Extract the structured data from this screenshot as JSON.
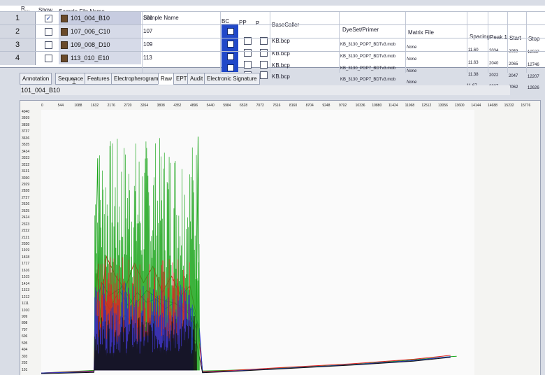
{
  "grid": {
    "headers": {
      "row": "R...",
      "show": "Show",
      "sample_file_name": "Sample File Name",
      "sample_name": "Sample Name",
      "bc": "BC",
      "pp": "PP",
      "p": "P",
      "base_caller": "BaseCaller",
      "dye_set_primer": "DyeSet/Primer",
      "matrix_file": "Matrix File",
      "spacing": "Spacing",
      "peak1": "Peak 1",
      "start": "Start",
      "stop": "Stop"
    },
    "rows": [
      {
        "num": "1",
        "checked": "✓",
        "file": "101_004_B10",
        "sample": "101",
        "basecaller": "KB.bcp",
        "dyeset": "KB_3130_POP7_BDTv3.mob",
        "matrix": "None",
        "spacing": "11.60",
        "peak1": "2034",
        "start": "2059",
        "stop": "12537"
      },
      {
        "num": "2",
        "checked": "",
        "file": "107_006_C10",
        "sample": "107",
        "basecaller": "KB.bcp",
        "dyeset": "KB_3130_POP7_BDTv3.mob",
        "matrix": "None",
        "spacing": "11.63",
        "peak1": "2040",
        "start": "2065",
        "stop": "12746"
      },
      {
        "num": "3",
        "checked": "",
        "file": "109_008_D10",
        "sample": "109",
        "basecaller": "KB.bcp",
        "dyeset": "KB_3130_POP7_BDTv3.mob",
        "matrix": "None",
        "spacing": "11.38",
        "peak1": "2022",
        "start": "2047",
        "stop": "12207"
      },
      {
        "num": "4",
        "checked": "",
        "file": "113_010_E10",
        "sample": "113",
        "basecaller": "KB.bcp",
        "dyeset": "KB_3130_POP7_BDTv3.mob",
        "matrix": "None",
        "spacing": "11.67",
        "peak1": "2037",
        "start": "2062",
        "stop": "12626"
      }
    ]
  },
  "tabs": [
    {
      "label": "Annotation",
      "active": false
    },
    {
      "label": "Sequence",
      "active": false
    },
    {
      "label": "Features",
      "active": false
    },
    {
      "label": "Electropherogram",
      "active": false
    },
    {
      "label": "Raw",
      "active": true
    },
    {
      "label": "EPT",
      "active": false
    },
    {
      "label": "Audit",
      "active": false
    },
    {
      "label": "Electronic Signature",
      "active": false
    }
  ],
  "sample_label": "101_004_B10",
  "colors": {
    "trace_red": "#e02020",
    "trace_green": "#1aa51a",
    "trace_blue": "#2030c8",
    "trace_black": "#111111",
    "basecaller_column": "#2148c8",
    "selected_file_bg": "#c7cce0"
  },
  "chart_data": {
    "type": "line",
    "title": "",
    "xlabel": "",
    "ylabel": "",
    "x_ticks": [
      "0",
      "544",
      "1088",
      "1632",
      "2176",
      "2720",
      "3264",
      "3808",
      "4352",
      "4896",
      "5440",
      "5984",
      "6528",
      "7072",
      "7616",
      "8160",
      "8704",
      "9248",
      "9792",
      "10336",
      "10880",
      "11424",
      "11968",
      "12512",
      "13056",
      "13600",
      "14144",
      "14688",
      "15232",
      "15776"
    ],
    "y_ticks": [
      "4040",
      "3939",
      "3838",
      "3737",
      "3636",
      "3535",
      "3434",
      "3333",
      "3232",
      "3131",
      "3030",
      "2929",
      "2828",
      "2727",
      "2626",
      "2525",
      "2424",
      "2323",
      "2222",
      "2121",
      "2020",
      "1919",
      "1818",
      "1717",
      "1616",
      "1515",
      "1414",
      "1313",
      "1212",
      "1111",
      "1010",
      "909",
      "808",
      "707",
      "606",
      "505",
      "404",
      "303",
      "202",
      "101"
    ],
    "xlim": [
      0,
      16000
    ],
    "ylim": [
      0,
      4040
    ],
    "series": [
      {
        "color": "#1aa51a",
        "x": [
          0,
          1700,
          1820,
          1880,
          1960,
          2200,
          2600,
          3000,
          3400,
          3800,
          4200,
          4600,
          4800,
          5000,
          5060,
          5100,
          5200,
          6000,
          8000,
          10000,
          12000,
          13200,
          13400
        ],
        "y": [
          20,
          60,
          3300,
          800,
          1200,
          1000,
          1350,
          1050,
          1280,
          1150,
          1100,
          1020,
          900,
          700,
          3630,
          600,
          50,
          60,
          100,
          150,
          220,
          270,
          275
        ]
      },
      {
        "color": "#e02020",
        "x": [
          0,
          1700,
          1800,
          1900,
          2100,
          2400,
          2700,
          3000,
          3300,
          3600,
          3900,
          4200,
          4500,
          4800,
          5000,
          5200,
          6000,
          8000,
          10000,
          12000,
          13200
        ],
        "y": [
          20,
          50,
          1600,
          900,
          1800,
          1500,
          1300,
          1700,
          1400,
          1650,
          1250,
          1500,
          1200,
          1350,
          900,
          40,
          55,
          110,
          160,
          230,
          290
        ]
      },
      {
        "color": "#2030c8",
        "x": [
          0,
          1700,
          1800,
          1950,
          2200,
          2500,
          2800,
          3100,
          3400,
          3700,
          4000,
          4300,
          4600,
          4900,
          5100,
          5200,
          6000,
          8000,
          10000,
          12000,
          13200
        ],
        "y": [
          20,
          40,
          1100,
          1400,
          1200,
          1300,
          1050,
          1250,
          1100,
          1150,
          1000,
          1100,
          950,
          1000,
          700,
          30,
          45,
          95,
          145,
          210,
          270
        ]
      },
      {
        "color": "#111111",
        "x": [
          0,
          1700,
          1900,
          2300,
          2700,
          3100,
          3500,
          3900,
          4300,
          4700,
          5000,
          5200,
          6000,
          8000,
          10000,
          12000,
          13200
        ],
        "y": [
          10,
          30,
          850,
          750,
          900,
          700,
          820,
          650,
          760,
          600,
          500,
          25,
          40,
          90,
          140,
          200,
          260
        ]
      }
    ]
  }
}
